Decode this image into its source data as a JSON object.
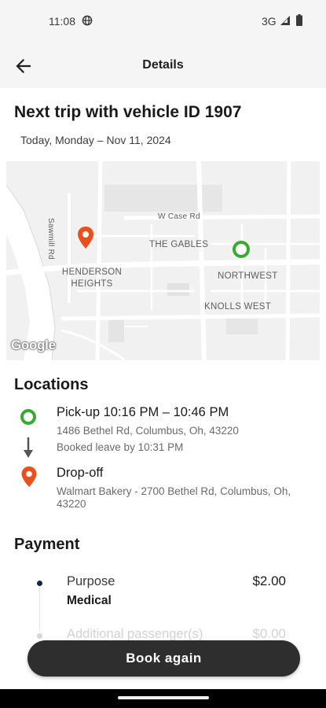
{
  "status_bar": {
    "time": "11:08",
    "network": "3G"
  },
  "header": {
    "title": "Details"
  },
  "trip": {
    "title": "Next trip with vehicle ID 1907",
    "date": "Today, Monday – Nov 11, 2024"
  },
  "map": {
    "labels": {
      "street_v": "Sawmill Rd",
      "w_case_rd": "W Case Rd",
      "the_gables": "THE GABLES",
      "henderson_heights": "HENDERSON HEIGHTS",
      "northwest": "NORTHWEST",
      "knolls_west": "KNOLLS WEST"
    },
    "logo": "Google"
  },
  "locations": {
    "heading": "Locations",
    "pickup": {
      "title": "Pick-up 10:16 PM – 10:46 PM",
      "address": "1486 Bethel Rd, Columbus, Oh, 43220",
      "note": "Booked leave by 10:31 PM"
    },
    "dropoff": {
      "title": "Drop-off",
      "address": "Walmart Bakery - 2700 Bethel Rd, Columbus, Oh, 43220"
    }
  },
  "payment": {
    "heading": "Payment",
    "items": [
      {
        "label": "Purpose",
        "sub": "Medical",
        "amount": "$2.00"
      },
      {
        "label": "Additional passenger(s)",
        "amount": "$0.00"
      }
    ]
  },
  "actions": {
    "book_again": "Book again"
  },
  "colors": {
    "pickup_green": "#3aa835",
    "dropoff_orange": "#e8501d",
    "button_dark": "#2e2e2e",
    "payment_dot": "#162447"
  },
  "icons": [
    "globe-icon",
    "signal-icon",
    "battery-icon",
    "back-arrow-icon",
    "pickup-pin-icon",
    "dropoff-pin-icon",
    "arrow-down-icon"
  ]
}
